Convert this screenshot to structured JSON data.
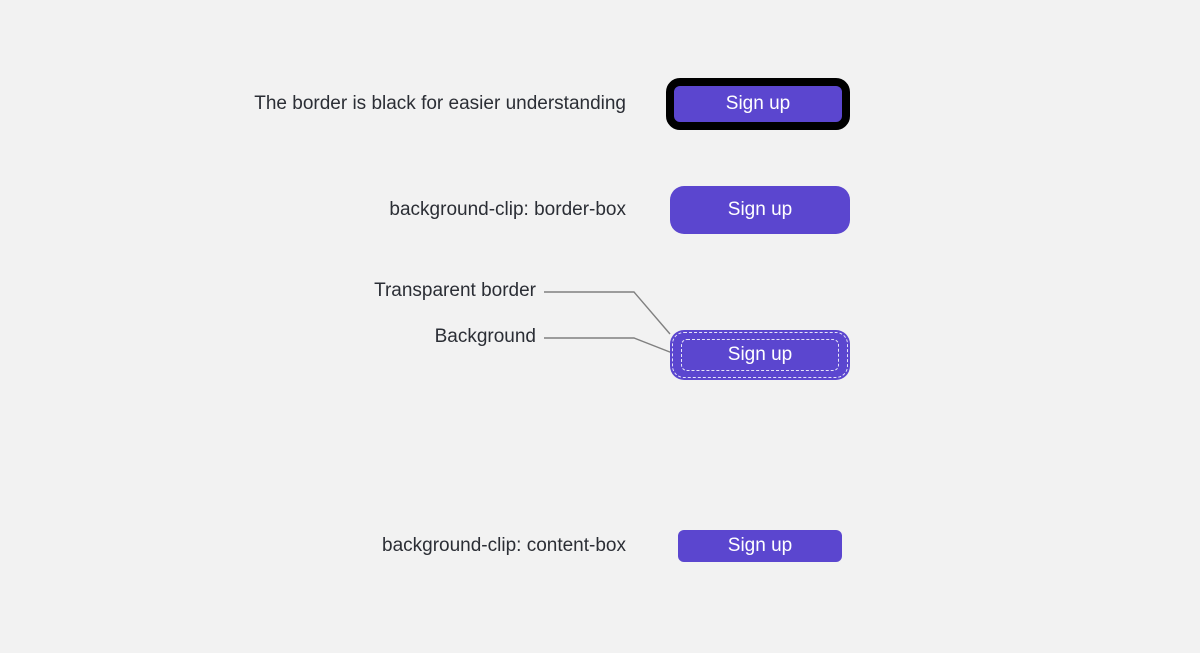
{
  "colors": {
    "accent": "#5b46cf",
    "border_demo": "#000000"
  },
  "rows": [
    {
      "label": "The border is black for easier understanding",
      "button": "Sign up"
    },
    {
      "label": "background-clip: border-box",
      "button": "Sign up"
    },
    {
      "button": "Sign up",
      "callouts": {
        "transparent_border": "Transparent border",
        "background": "Background"
      }
    },
    {
      "label": "background-clip: content-box",
      "button": "Sign up"
    }
  ]
}
